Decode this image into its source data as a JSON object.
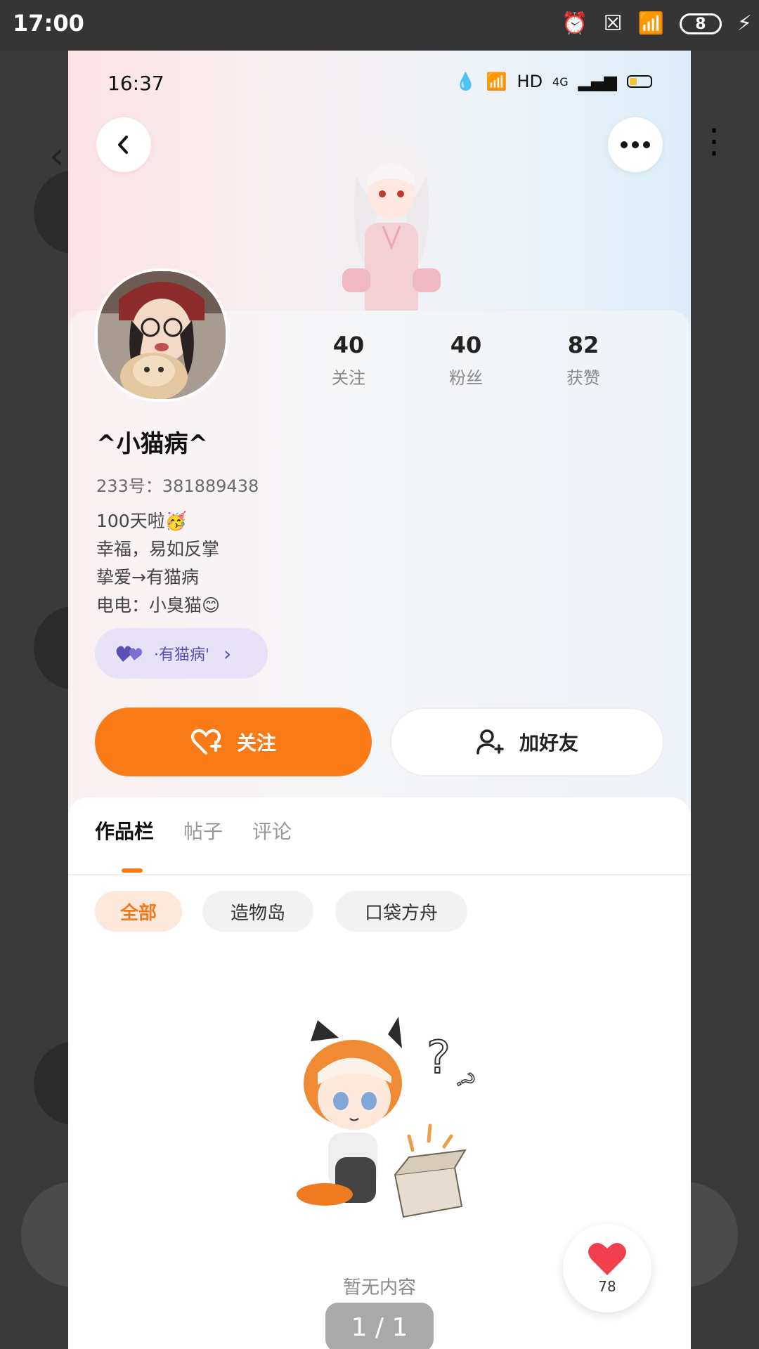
{
  "outer_status": {
    "time": "17:00",
    "battery": "8"
  },
  "inner_status": {
    "time": "16:37",
    "network": "HD",
    "signal_type": "4G"
  },
  "profile": {
    "nickname": "^小猫病^",
    "id_line": "233号：381889438",
    "bio": [
      "100天啦🥳",
      "幸福，易如反掌",
      "挚爱→有猫病",
      "电电：小臭猫😊"
    ],
    "tag": "·有猫病'",
    "stats": [
      {
        "value": "40",
        "label": "关注"
      },
      {
        "value": "40",
        "label": "粉丝"
      },
      {
        "value": "82",
        "label": "获赞"
      }
    ]
  },
  "actions": {
    "follow": "关注",
    "add_friend": "加好友"
  },
  "tabs": [
    {
      "label": "作品栏",
      "active": true
    },
    {
      "label": "帖子",
      "active": false
    },
    {
      "label": "评论",
      "active": false
    }
  ],
  "filters": [
    {
      "label": "全部",
      "active": true
    },
    {
      "label": "造物岛",
      "active": false
    },
    {
      "label": "口袋方舟",
      "active": false
    }
  ],
  "empty_state": "暂无内容",
  "like_float": {
    "count": "78"
  },
  "pager": "1 / 1",
  "colors": {
    "accent": "#f97b17",
    "tag_bg": "#e7e2f6",
    "tag_text": "#5a4fb2"
  }
}
